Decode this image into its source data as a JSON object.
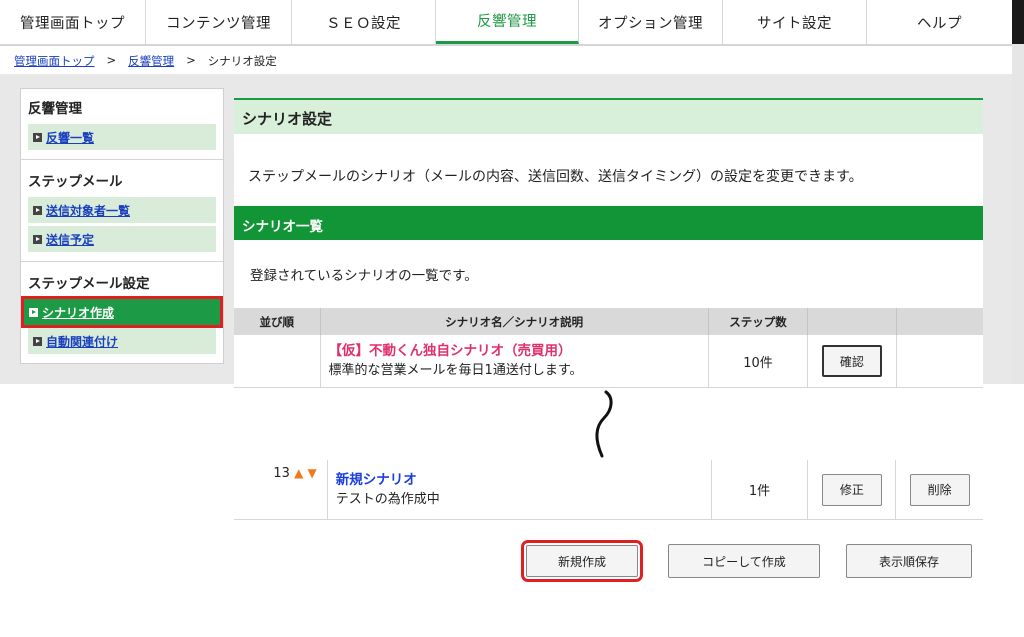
{
  "nav": {
    "tabs": [
      {
        "label": "管理画面トップ"
      },
      {
        "label": "コンテンツ管理"
      },
      {
        "label": "ＳＥＯ設定"
      },
      {
        "label": "反響管理"
      },
      {
        "label": "オプション管理"
      },
      {
        "label": "サイト設定"
      },
      {
        "label": "ヘルプ"
      }
    ],
    "active_index": 3
  },
  "breadcrumb": {
    "items": [
      "管理画面トップ",
      "反響管理",
      "シナリオ設定"
    ],
    "separator": ">"
  },
  "sidebar": {
    "groups": [
      {
        "heading": "反響管理",
        "items": [
          "反響一覧"
        ]
      },
      {
        "heading": "ステップメール",
        "items": [
          "送信対象者一覧",
          "送信予定"
        ]
      },
      {
        "heading": "ステップメール設定",
        "items": [
          "シナリオ作成",
          "自動関連付け"
        ]
      }
    ]
  },
  "main": {
    "title": "シナリオ設定",
    "description": "ステップメールのシナリオ（メールの内容、送信回数、送信タイミング）の設定を変更できます。",
    "section_title": "シナリオ一覧",
    "list_description": "登録されているシナリオの一覧です。",
    "table": {
      "headers": [
        "並び順",
        "シナリオ名／シナリオ説明",
        "ステップ数",
        "",
        ""
      ],
      "rows": [
        {
          "order": "",
          "name": "【仮】不動くん独自シナリオ（売買用）",
          "desc": "標準的な営業メールを毎日1通送付します。",
          "steps": "10件",
          "btn1": "確認",
          "btn2": ""
        },
        {
          "order": "13",
          "name": "新規シナリオ",
          "desc": "テストの為作成中",
          "steps": "1件",
          "btn1": "修正",
          "btn2": "削除"
        }
      ]
    },
    "arrows": {
      "up": "▲",
      "down": "▼"
    }
  },
  "actions": {
    "new": "新規作成",
    "copy": "コピーして作成",
    "save_order": "表示順保存"
  },
  "colors": {
    "accent_green": "#1d9a45",
    "section_green": "#119537",
    "highlight_red": "#e02020",
    "scenario_pink": "#e0306a",
    "link_blue": "#1a3fbf"
  }
}
